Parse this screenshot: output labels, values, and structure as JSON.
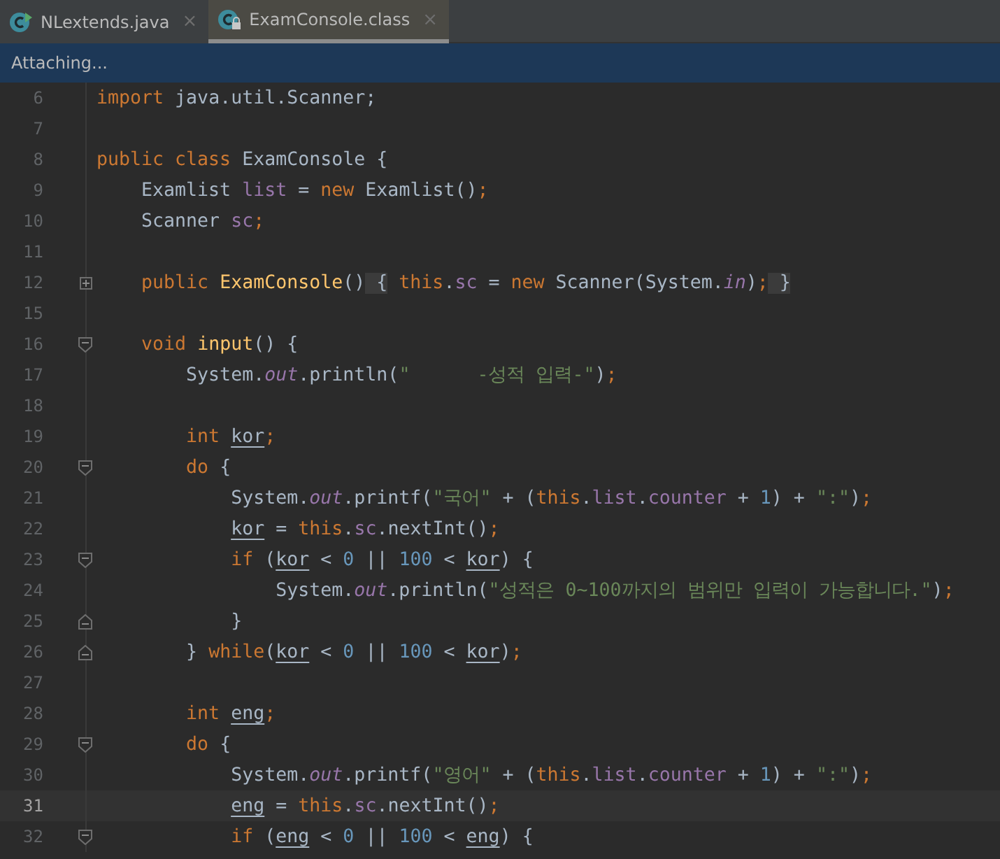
{
  "tabs": [
    {
      "label": "NLextends.java",
      "kind": "runnable",
      "close": "×",
      "selected": false
    },
    {
      "label": "ExamConsole.class",
      "kind": "locked",
      "close": "×",
      "selected": true
    }
  ],
  "notification": {
    "text": "Attaching..."
  },
  "editor": {
    "lines": [
      {
        "number": "6",
        "current": false,
        "tokens": [
          {
            "kind": "kw",
            "t": "import "
          },
          {
            "kind": "plain",
            "t": "java.util.Scanner;"
          }
        ]
      },
      {
        "number": "7",
        "current": false
      },
      {
        "number": "8",
        "current": false,
        "tokens": [
          {
            "kind": "kw",
            "t": "public class "
          },
          {
            "kind": "plain",
            "t": "ExamConsole {"
          }
        ]
      },
      {
        "number": "9",
        "current": false,
        "tokens": [
          {
            "kind": "plain",
            "t": "    Examlist "
          },
          {
            "kind": "field",
            "t": "list"
          },
          {
            "kind": "plain",
            "t": " = "
          },
          {
            "kind": "kw",
            "t": "new "
          },
          {
            "kind": "plain",
            "t": "Examlist()"
          },
          {
            "kind": "kw",
            "t": ";"
          }
        ]
      },
      {
        "number": "10",
        "current": false,
        "tokens": [
          {
            "kind": "plain",
            "t": "    Scanner "
          },
          {
            "kind": "field",
            "t": "sc"
          },
          {
            "kind": "kw",
            "t": ";"
          }
        ]
      },
      {
        "number": "11",
        "current": false
      },
      {
        "number": "12",
        "marker": {
          "kind": "expand"
        },
        "current": false,
        "tokens": [
          {
            "kind": "kw",
            "t": "    public "
          },
          {
            "kind": "fn",
            "t": "ExamConsole"
          },
          {
            "kind": "plain",
            "t": "()"
          },
          {
            "kind": "folded",
            "t": " {"
          },
          {
            "kind": "kw",
            "t": " this"
          },
          {
            "kind": "plain",
            "t": "."
          },
          {
            "kind": "field",
            "t": "sc"
          },
          {
            "kind": "plain",
            "t": " = "
          },
          {
            "kind": "kw",
            "t": "new "
          },
          {
            "kind": "plain",
            "t": "Scanner(System."
          },
          {
            "kind": "static",
            "t": "in"
          },
          {
            "kind": "plain",
            "t": ")"
          },
          {
            "kind": "kw",
            "t": ";"
          },
          {
            "kind": "folded",
            "t": " }"
          }
        ]
      },
      {
        "number": "15",
        "current": false
      },
      {
        "number": "16",
        "marker": {
          "kind": "collapse"
        },
        "current": false,
        "tokens": [
          {
            "kind": "kw",
            "t": "    void "
          },
          {
            "kind": "fn",
            "t": "input"
          },
          {
            "kind": "plain",
            "t": "() {"
          }
        ]
      },
      {
        "number": "17",
        "current": false,
        "tokens": [
          {
            "kind": "plain",
            "t": "        System."
          },
          {
            "kind": "static",
            "t": "out"
          },
          {
            "kind": "plain",
            "t": ".println("
          },
          {
            "kind": "str",
            "t": "\"      -성적 입력-\""
          },
          {
            "kind": "plain",
            "t": ")"
          },
          {
            "kind": "kw",
            "t": ";"
          }
        ]
      },
      {
        "number": "18",
        "current": false
      },
      {
        "number": "19",
        "current": false,
        "tokens": [
          {
            "kind": "kw",
            "t": "        int "
          },
          {
            "kind": "local",
            "t": "kor"
          },
          {
            "kind": "kw",
            "t": ";"
          }
        ]
      },
      {
        "number": "20",
        "marker": {
          "kind": "collapse"
        },
        "current": false,
        "tokens": [
          {
            "kind": "kw",
            "t": "        do "
          },
          {
            "kind": "plain",
            "t": "{"
          }
        ]
      },
      {
        "number": "21",
        "current": false,
        "tokens": [
          {
            "kind": "plain",
            "t": "            System."
          },
          {
            "kind": "static",
            "t": "out"
          },
          {
            "kind": "plain",
            "t": ".printf("
          },
          {
            "kind": "str",
            "t": "\"국어\""
          },
          {
            "kind": "plain",
            "t": " + ("
          },
          {
            "kind": "kw",
            "t": "this"
          },
          {
            "kind": "plain",
            "t": "."
          },
          {
            "kind": "field",
            "t": "list"
          },
          {
            "kind": "plain",
            "t": "."
          },
          {
            "kind": "field",
            "t": "counter"
          },
          {
            "kind": "plain",
            "t": " + "
          },
          {
            "kind": "num",
            "t": "1"
          },
          {
            "kind": "plain",
            "t": ") + "
          },
          {
            "kind": "str",
            "t": "\":\""
          },
          {
            "kind": "plain",
            "t": ")"
          },
          {
            "kind": "kw",
            "t": ";"
          }
        ]
      },
      {
        "number": "22",
        "current": false,
        "tokens": [
          {
            "kind": "local",
            "t": "            kor"
          },
          {
            "kind": "plain",
            "t": " = "
          },
          {
            "kind": "kw",
            "t": "this"
          },
          {
            "kind": "plain",
            "t": "."
          },
          {
            "kind": "field",
            "t": "sc"
          },
          {
            "kind": "plain",
            "t": ".nextInt()"
          },
          {
            "kind": "kw",
            "t": ";"
          }
        ]
      },
      {
        "number": "23",
        "marker": {
          "kind": "collapse"
        },
        "current": false,
        "tokens": [
          {
            "kind": "kw",
            "t": "            if "
          },
          {
            "kind": "plain",
            "t": "("
          },
          {
            "kind": "local",
            "t": "kor"
          },
          {
            "kind": "plain",
            "t": " < "
          },
          {
            "kind": "num",
            "t": "0"
          },
          {
            "kind": "plain",
            "t": " || "
          },
          {
            "kind": "num",
            "t": "100"
          },
          {
            "kind": "plain",
            "t": " < "
          },
          {
            "kind": "local",
            "t": "kor"
          },
          {
            "kind": "plain",
            "t": ") {"
          }
        ]
      },
      {
        "number": "24",
        "current": false,
        "tokens": [
          {
            "kind": "plain",
            "t": "                System."
          },
          {
            "kind": "static",
            "t": "out"
          },
          {
            "kind": "plain",
            "t": ".println("
          },
          {
            "kind": "str",
            "t": "\"성적은 0~100까지의 범위만 입력이 가능합니다.\""
          },
          {
            "kind": "plain",
            "t": ")"
          },
          {
            "kind": "kw",
            "t": ";"
          }
        ]
      },
      {
        "number": "25",
        "marker": {
          "kind": "end"
        },
        "current": false,
        "tokens": [
          {
            "kind": "plain",
            "t": "            }"
          }
        ]
      },
      {
        "number": "26",
        "marker": {
          "kind": "end"
        },
        "current": false,
        "tokens": [
          {
            "kind": "plain",
            "t": "        } "
          },
          {
            "kind": "kw",
            "t": "while"
          },
          {
            "kind": "plain",
            "t": "("
          },
          {
            "kind": "local",
            "t": "kor"
          },
          {
            "kind": "plain",
            "t": " < "
          },
          {
            "kind": "num",
            "t": "0"
          },
          {
            "kind": "plain",
            "t": " || "
          },
          {
            "kind": "num",
            "t": "100"
          },
          {
            "kind": "plain",
            "t": " < "
          },
          {
            "kind": "local",
            "t": "kor"
          },
          {
            "kind": "plain",
            "t": ")"
          },
          {
            "kind": "kw",
            "t": ";"
          }
        ]
      },
      {
        "number": "27",
        "current": false
      },
      {
        "number": "28",
        "current": false,
        "tokens": [
          {
            "kind": "kw",
            "t": "        int "
          },
          {
            "kind": "local",
            "t": "eng"
          },
          {
            "kind": "kw",
            "t": ";"
          }
        ]
      },
      {
        "number": "29",
        "marker": {
          "kind": "collapse"
        },
        "current": false,
        "tokens": [
          {
            "kind": "kw",
            "t": "        do "
          },
          {
            "kind": "plain",
            "t": "{"
          }
        ]
      },
      {
        "number": "30",
        "current": false,
        "tokens": [
          {
            "kind": "plain",
            "t": "            System."
          },
          {
            "kind": "static",
            "t": "out"
          },
          {
            "kind": "plain",
            "t": ".printf("
          },
          {
            "kind": "str",
            "t": "\"영어\""
          },
          {
            "kind": "plain",
            "t": " + ("
          },
          {
            "kind": "kw",
            "t": "this"
          },
          {
            "kind": "plain",
            "t": "."
          },
          {
            "kind": "field",
            "t": "list"
          },
          {
            "kind": "plain",
            "t": "."
          },
          {
            "kind": "field",
            "t": "counter"
          },
          {
            "kind": "plain",
            "t": " + "
          },
          {
            "kind": "num",
            "t": "1"
          },
          {
            "kind": "plain",
            "t": ") + "
          },
          {
            "kind": "str",
            "t": "\":\""
          },
          {
            "kind": "plain",
            "t": ")"
          },
          {
            "kind": "kw",
            "t": ";"
          }
        ]
      },
      {
        "number": "31",
        "current": true,
        "tokens": [
          {
            "kind": "local",
            "t": "            eng"
          },
          {
            "kind": "plain",
            "t": " = "
          },
          {
            "kind": "kw",
            "t": "this"
          },
          {
            "kind": "plain",
            "t": "."
          },
          {
            "kind": "field",
            "t": "sc"
          },
          {
            "kind": "plain",
            "t": ".nextInt()"
          },
          {
            "kind": "kw",
            "t": ";"
          }
        ]
      },
      {
        "number": "32",
        "marker": {
          "kind": "collapse"
        },
        "current": false,
        "tokens": [
          {
            "kind": "kw",
            "t": "            if "
          },
          {
            "kind": "plain",
            "t": "("
          },
          {
            "kind": "local",
            "t": "eng"
          },
          {
            "kind": "plain",
            "t": " < "
          },
          {
            "kind": "num",
            "t": "0"
          },
          {
            "kind": "plain",
            "t": " || "
          },
          {
            "kind": "num",
            "t": "100"
          },
          {
            "kind": "plain",
            "t": " < "
          },
          {
            "kind": "local",
            "t": "eng"
          },
          {
            "kind": "plain",
            "t": ") {"
          }
        ]
      }
    ]
  }
}
